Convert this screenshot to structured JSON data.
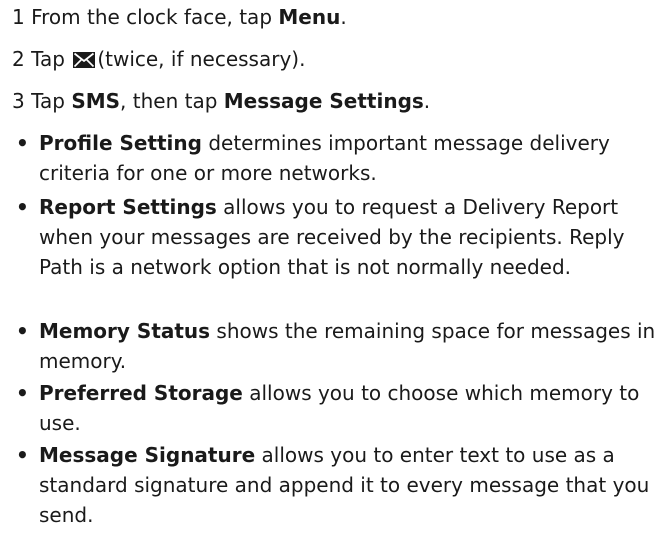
{
  "steps": [
    {
      "number": "1",
      "prefix": "From the clock face, tap ",
      "bold": "Menu",
      "suffix": "."
    },
    {
      "number": "2",
      "prefix": "Tap",
      "icon": "envelope-icon",
      "suffix": "(twice, if necessary)."
    },
    {
      "number": "3",
      "prefix": "Tap ",
      "bold": "SMS",
      "middle": ", then tap ",
      "bold2": "Message Settings",
      "suffix": "."
    }
  ],
  "bullets": [
    {
      "term": "Profile Setting",
      "description": " determines important message delivery criteria for one or more networks."
    },
    {
      "term": "Report Settings",
      "description": " allows you to request a Delivery Report when your messages are received by the recipients. Reply Path is a network option that is not normally needed."
    },
    {
      "term": "Memory Status",
      "description": " shows the remaining space for messages in memory."
    },
    {
      "term": "Preferred Storage",
      "description": " allows you to choose which memory to use."
    },
    {
      "term": "Message Signature",
      "description": " allows you to enter text to use as a standard signature and append it to every message that you send."
    }
  ],
  "bullet_symbol": "•",
  "colors": {
    "text": "#1a1a1a",
    "background": "#ffffff"
  }
}
